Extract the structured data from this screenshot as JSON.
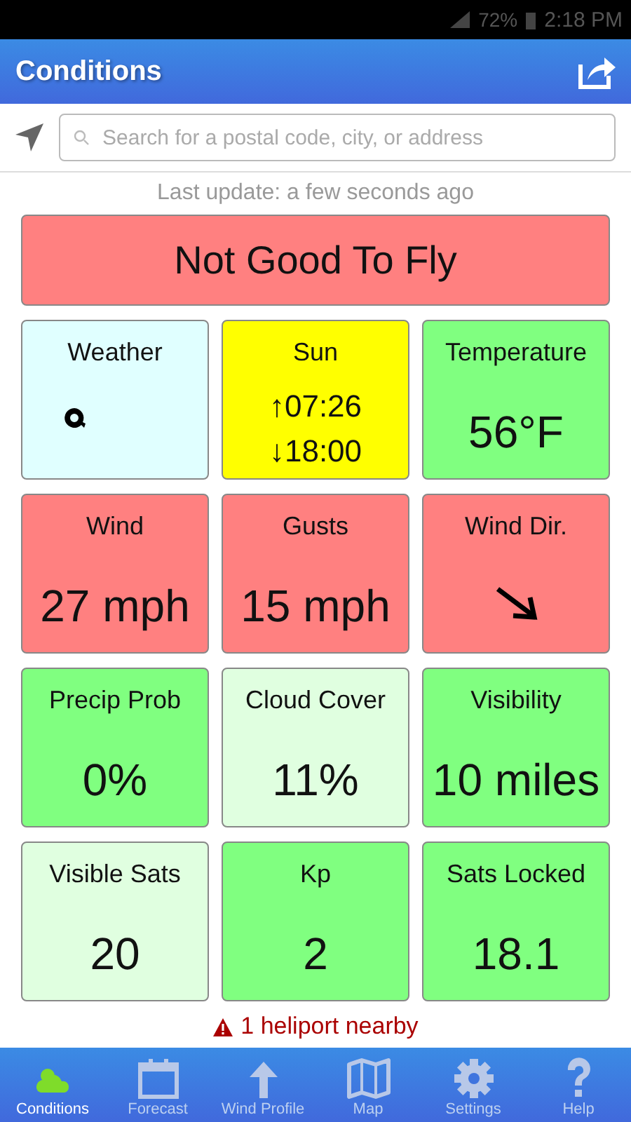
{
  "status_bar": {
    "battery": "72%",
    "time": "2:18 PM"
  },
  "app_bar": {
    "title": "Conditions"
  },
  "search": {
    "placeholder": "Search for a postal code, city, or address"
  },
  "last_update": "Last update: a few seconds ago",
  "verdict": {
    "text": "Not Good To Fly",
    "color": "#ff8080"
  },
  "tiles": [
    {
      "kind": "weather",
      "label": "Weather",
      "color": "#e0ffff"
    },
    {
      "kind": "sun",
      "label": "Sun",
      "rise": "↑07:26",
      "set": "↓18:00",
      "color": "#ffff00"
    },
    {
      "kind": "value",
      "label": "Temperature",
      "value": "56°F",
      "color": "#80ff80"
    },
    {
      "kind": "value",
      "label": "Wind",
      "value": "27 mph",
      "color": "#ff8080"
    },
    {
      "kind": "value",
      "label": "Gusts",
      "value": "15 mph",
      "color": "#ff8080"
    },
    {
      "kind": "direction",
      "label": "Wind Dir.",
      "color": "#ff8080"
    },
    {
      "kind": "value",
      "label": "Precip Prob",
      "value": "0%",
      "color": "#80ff80"
    },
    {
      "kind": "value",
      "label": "Cloud Cover",
      "value": "11%",
      "color": "#e0ffe0"
    },
    {
      "kind": "value",
      "label": "Visibility",
      "value": "10 miles",
      "color": "#80ff80"
    },
    {
      "kind": "value",
      "label": "Visible Sats",
      "value": "20",
      "color": "#e0ffe0"
    },
    {
      "kind": "value",
      "label": "Kp",
      "value": "2",
      "color": "#80ff80"
    },
    {
      "kind": "value",
      "label": "Sats Locked",
      "value": "18.1",
      "color": "#80ff80"
    }
  ],
  "alert": "1 heliport nearby",
  "tabs": [
    {
      "kind": "conditions",
      "label": "Conditions",
      "selected": true
    },
    {
      "kind": "forecast",
      "label": "Forecast",
      "selected": false
    },
    {
      "kind": "wind",
      "label": "Wind Profile",
      "selected": false
    },
    {
      "kind": "map",
      "label": "Map",
      "selected": false
    },
    {
      "kind": "settings",
      "label": "Settings",
      "selected": false
    },
    {
      "kind": "help",
      "label": "Help",
      "selected": false
    }
  ]
}
